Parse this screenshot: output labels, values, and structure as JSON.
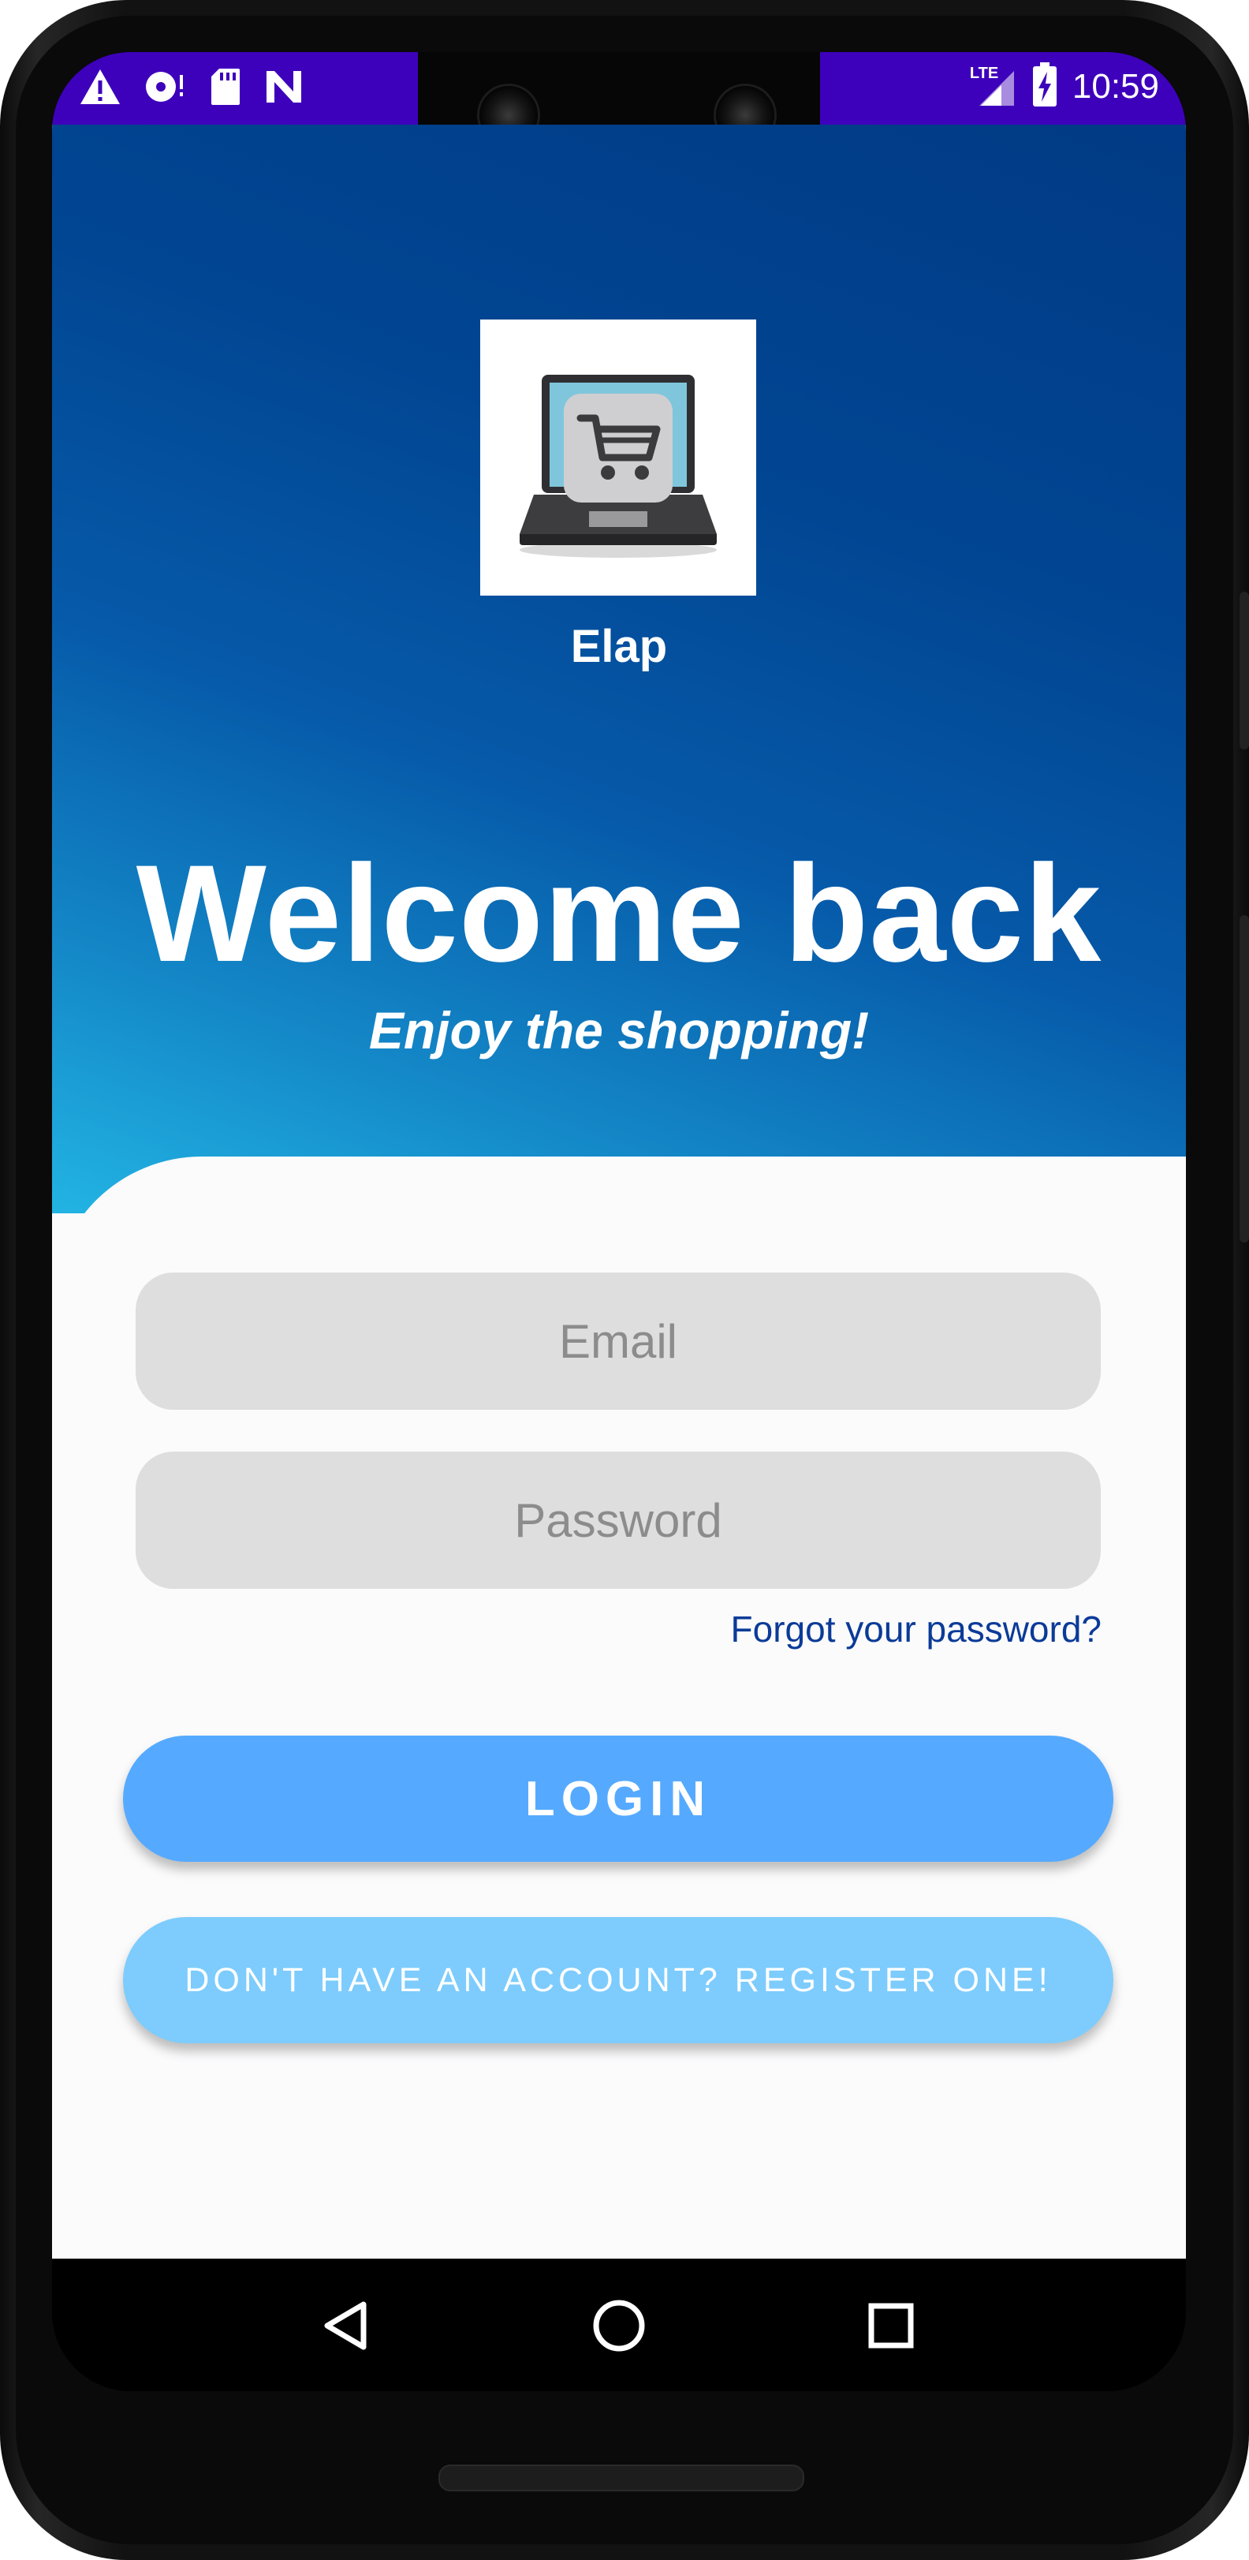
{
  "status_bar": {
    "time": "10:59",
    "network": "LTE",
    "icons_left": [
      "warning-icon",
      "disc-icon",
      "sd-card-icon",
      "n-notification-icon"
    ],
    "icons_right": [
      "signal-icon",
      "battery-charging-icon"
    ],
    "color": "#3e01bb"
  },
  "app": {
    "name": "Elap",
    "logo_icon": "laptop-shopping-cart-icon"
  },
  "hero": {
    "title": "Welcome back",
    "subtitle": "Enjoy the shopping!",
    "gradient_colors": [
      "#013a85",
      "#22b4e3"
    ]
  },
  "form": {
    "email_placeholder": "Email",
    "email_value": "",
    "password_placeholder": "Password",
    "password_value": "",
    "forgot_link": "Forgot your password?",
    "login_button": "LOGIN",
    "register_button": "DON'T HAVE AN ACCOUNT? REGISTER ONE!",
    "login_color": "#55aaff",
    "register_color": "#7dccfd"
  },
  "nav_bar": {
    "items": [
      "back-icon",
      "home-icon",
      "recents-icon"
    ]
  }
}
